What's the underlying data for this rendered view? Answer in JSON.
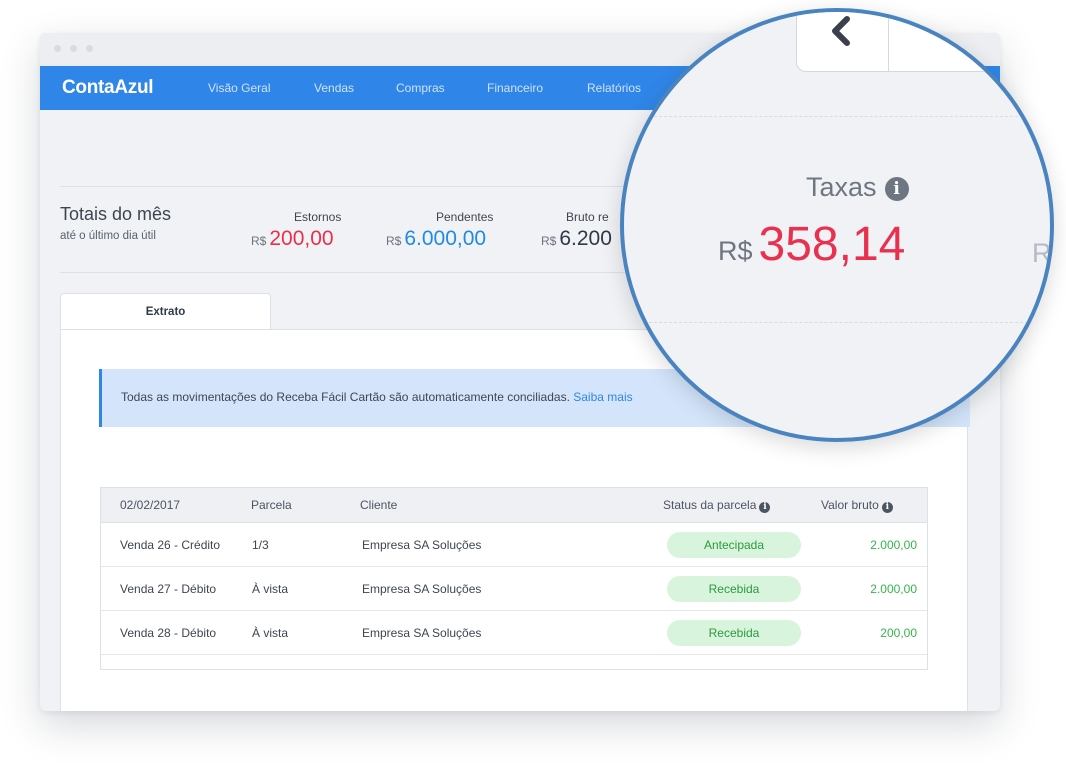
{
  "app": {
    "brand": "ContaAzul"
  },
  "nav": {
    "items": [
      {
        "label": "Visão Geral"
      },
      {
        "label": "Vendas"
      },
      {
        "label": "Compras"
      },
      {
        "label": "Financeiro"
      },
      {
        "label": "Relatórios"
      }
    ]
  },
  "totals": {
    "title": "Totais do mês",
    "subtitle": "até o último dia útil",
    "currency": "R$",
    "estornos": {
      "label": "Estornos",
      "value": "200,00"
    },
    "pendentes": {
      "label": "Pendentes",
      "value": "6.000,00"
    },
    "bruto": {
      "label": "Bruto re",
      "value": "6.200"
    }
  },
  "tabs": {
    "extrato": "Extrato"
  },
  "alert": {
    "text": "Todas as movimentações do Receba Fácil Cartão são automaticamente conciliadas.",
    "link": "Saiba mais"
  },
  "table": {
    "headers": {
      "date": "02/02/2017",
      "parcela": "Parcela",
      "cliente": "Cliente",
      "status": "Status da parcela",
      "valor": "Valor bruto"
    },
    "rows": [
      {
        "venda": "Venda 26 - Crédito",
        "parcela": "1/3",
        "cliente": "Empresa SA Soluções",
        "status": "Antecipada",
        "valor": "2.000,00"
      },
      {
        "venda": "Venda 27 - Débito",
        "parcela": "À vista",
        "cliente": "Empresa SA Soluções",
        "status": "Recebida",
        "valor": "2.000,00"
      },
      {
        "venda": "Venda 28 - Débito",
        "parcela": "À vista",
        "cliente": "Empresa SA Soluções",
        "status": "Recebida",
        "valor": "200,00"
      }
    ]
  },
  "zoom": {
    "label": "Taxas",
    "currency": "R$",
    "value": "358,14",
    "cut_currency": "R"
  },
  "colors": {
    "primary": "#2f86e8",
    "negative": "#e8304f",
    "positive": "#35b54a",
    "info": "#1f8be6"
  },
  "icons": [
    "info-icon",
    "chevron-left-icon"
  ]
}
